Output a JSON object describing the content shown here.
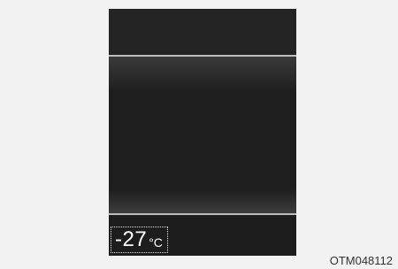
{
  "display": {
    "temperature_value": "-27",
    "temperature_unit": "°C"
  },
  "figure_code": "OTM048112"
}
